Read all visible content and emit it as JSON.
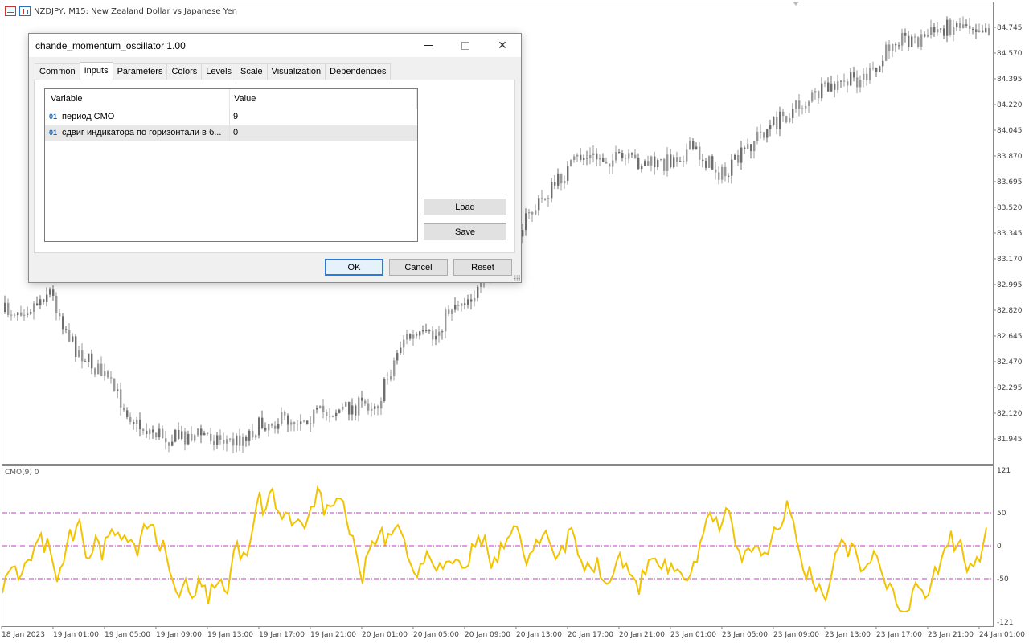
{
  "window": {
    "title": "NZDJPY, M15:  New Zealand Dollar vs Japanese Yen"
  },
  "indicator_label": "CMO(9) 0",
  "price_axis": [
    "84.745",
    "84.570",
    "84.395",
    "84.220",
    "84.045",
    "83.870",
    "83.695",
    "83.520",
    "83.345",
    "83.170",
    "82.995",
    "82.820",
    "82.645",
    "82.470",
    "82.295",
    "82.120",
    "81.945"
  ],
  "osc_axis": [
    "121",
    "50",
    "0",
    "-50",
    "-121"
  ],
  "time_axis": [
    "18 Jan 2023",
    "19 Jan 01:00",
    "19 Jan 05:00",
    "19 Jan 09:00",
    "19 Jan 13:00",
    "19 Jan 17:00",
    "19 Jan 21:00",
    "20 Jan 01:00",
    "20 Jan 05:00",
    "20 Jan 09:00",
    "20 Jan 13:00",
    "20 Jan 17:00",
    "20 Jan 21:00",
    "23 Jan 01:00",
    "23 Jan 05:00",
    "23 Jan 09:00",
    "23 Jan 13:00",
    "23 Jan 17:00",
    "23 Jan 21:00",
    "24 Jan 01:00"
  ],
  "colors": {
    "candle": "#9a9a9a",
    "candle_dark": "#6e6e6e",
    "cmo_line": "#f2c400",
    "level_line": "#c43bc4",
    "grid": "#d8d8d8",
    "axis_text": "#404040"
  },
  "dialog": {
    "title": "chande_momentum_oscillator 1.00",
    "tabs": [
      "Common",
      "Inputs",
      "Parameters",
      "Colors",
      "Levels",
      "Scale",
      "Visualization",
      "Dependencies"
    ],
    "active_tab": "Inputs",
    "table": {
      "col_variable": "Variable",
      "col_value": "Value",
      "rows": [
        {
          "type": "01",
          "name": "период CMO",
          "value": "9"
        },
        {
          "type": "01",
          "name": "сдвиг индикатора по горизонтали в б...",
          "value": "0"
        }
      ]
    },
    "load_label": "Load",
    "save_label": "Save",
    "ok_label": "OK",
    "cancel_label": "Cancel",
    "reset_label": "Reset"
  }
}
